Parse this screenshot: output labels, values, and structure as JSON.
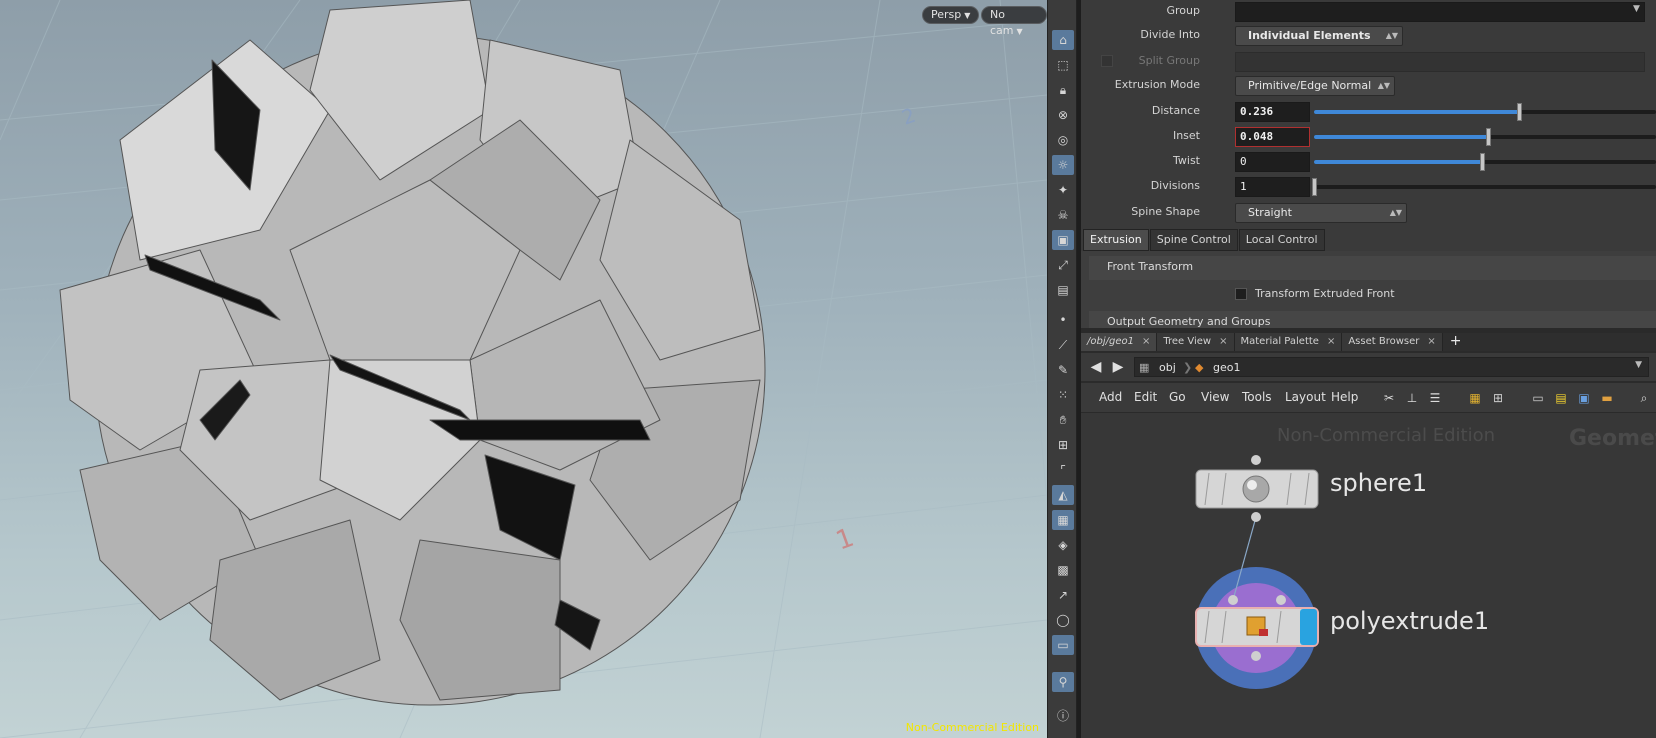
{
  "viewport": {
    "view_menu": "Persp",
    "camera_menu": "No cam",
    "watermark": "Non-Commercial Edition",
    "axis_labels": [
      "1",
      "2"
    ]
  },
  "toolbar": {
    "icons": [
      "view-icon",
      "select-icon",
      "lock-icon",
      "snap-icon",
      "display-icon",
      "light-icon",
      "bulb-icon",
      "skull-icon",
      "camera-icon",
      "handle-icon",
      "render-icon",
      "point-icon",
      "brush-icon",
      "pen-icon",
      "number-icon",
      "hand-icon",
      "grid-number-icon",
      "corner-icon",
      "sculpt-icon",
      "texture-icon",
      "uv-icon",
      "map-icon",
      "vector-icon",
      "circle-icon",
      "image-icon",
      "pin-icon",
      "info-icon"
    ]
  },
  "parameters": {
    "group_label": "Group",
    "divide_into_label": "Divide Into",
    "divide_into_value": "Individual Elements",
    "split_group_label": "Split Group",
    "extrusion_mode_label": "Extrusion Mode",
    "extrusion_mode_value": "Primitive/Edge Normal",
    "distance_label": "Distance",
    "distance_value": "0.236",
    "distance_fraction": 0.6,
    "inset_label": "Inset",
    "inset_value": "0.048",
    "inset_fraction": 0.51,
    "twist_label": "Twist",
    "twist_value": "0",
    "twist_fraction": 0.49,
    "divisions_label": "Divisions",
    "divisions_value": "1",
    "divisions_fraction": 0.0,
    "spine_shape_label": "Spine Shape",
    "spine_shape_value": "Straight"
  },
  "param_tabs": [
    "Extrusion",
    "Spine Control",
    "Local Control"
  ],
  "folders": {
    "front_transform": "Front Transform",
    "transform_front_label": "Transform Extruded Front",
    "output_geometry": "Output Geometry and Groups"
  },
  "pane_tabs": [
    {
      "label": "/obj/geo1"
    },
    {
      "label": "Tree View"
    },
    {
      "label": "Material Palette"
    },
    {
      "label": "Asset Browser"
    }
  ],
  "path": {
    "crumb1": "obj",
    "crumb2": "geo1"
  },
  "network_menu": [
    "Add",
    "Edit",
    "Go",
    "View",
    "Tools",
    "Layout",
    "Help"
  ],
  "network": {
    "watermark": "Non-Commercial Edition",
    "context_label": "Geometry",
    "nodes": [
      {
        "name": "sphere1"
      },
      {
        "name": "polyextrude1"
      }
    ]
  },
  "colors": {
    "accent_blue": "#3f88d8",
    "watermark_yellow": "#f2e600",
    "display_flag": "#29a3e0",
    "footprint_purple": "#9a6ed0",
    "footprint_blue": "#4a70b8"
  }
}
